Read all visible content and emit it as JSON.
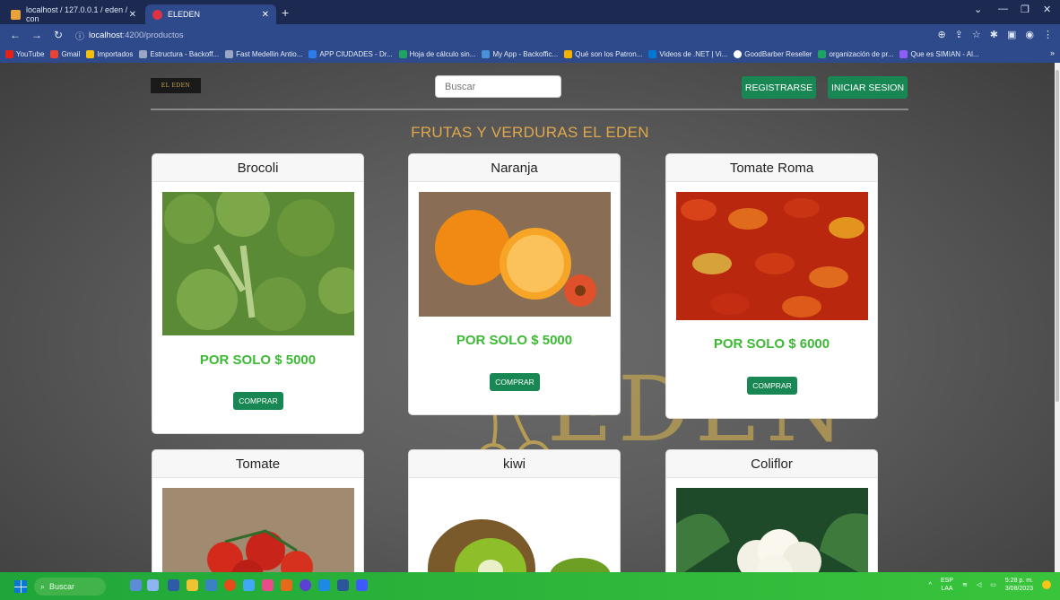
{
  "browser": {
    "tabs": [
      {
        "title": "localhost / 127.0.0.1 / eden / con",
        "active": false
      },
      {
        "title": "ELEDEN",
        "active": true
      }
    ],
    "url_host": "localhost",
    "url_path": ":4200/productos",
    "bookmarks": [
      "YouTube",
      "Gmail",
      "Importados",
      "Estructura - Backoff...",
      "Fast Medellin Antio...",
      "APP CIUDADES - Dr...",
      "Hoja de cálculo sin...",
      "My App - Backoffic...",
      "Qué son los Patron...",
      "Videos de .NET | Vi...",
      "GoodBarber Reseller",
      "organización de pr...",
      "Que es SIMIAN - Al..."
    ]
  },
  "header": {
    "logo_text": "EL EDEN",
    "search_placeholder": "Buscar",
    "register_label": "REGISTRARSE",
    "login_label": "INICIAR SESION"
  },
  "page_title": "FRUTAS Y VERDURAS EL EDEN",
  "watermark_text": "EDEN",
  "products": [
    {
      "name": "Brocoli",
      "price": "POR SOLO $ 5000",
      "buy_label": "COMPRAR"
    },
    {
      "name": "Naranja",
      "price": "POR SOLO $ 5000",
      "buy_label": "COMPRAR"
    },
    {
      "name": "Tomate Roma",
      "price": "POR SOLO $ 6000",
      "buy_label": "COMPRAR"
    },
    {
      "name": "Tomate",
      "price": "",
      "buy_label": ""
    },
    {
      "name": "kiwi",
      "price": "",
      "buy_label": ""
    },
    {
      "name": "Coliflor",
      "price": "",
      "buy_label": ""
    }
  ],
  "taskbar": {
    "search_label": "Buscar",
    "lang_top": "ESP",
    "lang_bottom": "LAA",
    "time": "5:28 p. m.",
    "date": "3/08/2023"
  },
  "colors": {
    "accent_green": "#198754",
    "price_green": "#3dba35",
    "title_orange": "#e0a84a",
    "browser_blue": "#2f4a8a"
  }
}
